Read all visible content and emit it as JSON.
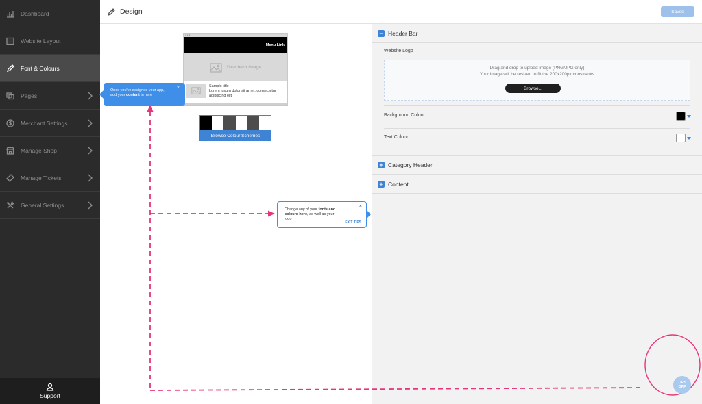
{
  "sidebar": {
    "items": [
      {
        "label": "Dashboard",
        "icon": "dashboard-icon",
        "chevron": false,
        "active": false
      },
      {
        "label": "Website Layout",
        "icon": "layout-icon",
        "chevron": false,
        "active": false
      },
      {
        "label": "Font & Colours",
        "icon": "pencil-icon",
        "chevron": false,
        "active": true
      },
      {
        "label": "Pages",
        "icon": "pages-icon",
        "chevron": true,
        "active": false
      },
      {
        "label": "Merchant Settings",
        "icon": "dollar-icon",
        "chevron": true,
        "active": false
      },
      {
        "label": "Manage Shop",
        "icon": "shop-icon",
        "chevron": true,
        "active": false
      },
      {
        "label": "Manage Tickets",
        "icon": "ticket-icon",
        "chevron": true,
        "active": false
      },
      {
        "label": "General Settings",
        "icon": "tools-icon",
        "chevron": true,
        "active": false
      }
    ],
    "support_label": "Support"
  },
  "topbar": {
    "title": "Design",
    "saved_label": "Saved"
  },
  "preview": {
    "menu_link": "Menu Link",
    "hero_text": "Your hero image",
    "sample_title": "Sample title",
    "sample_body": "Lorem ipsum dolor sit amet, consectetur adipiscing elit.",
    "swatch_colors": [
      "#000000",
      "#ffffff",
      "#4d4d4d",
      "#ffffff",
      "#4d4d4d",
      "#ffffff"
    ],
    "browse_schemes": "Browse Colour Schemes"
  },
  "panel": {
    "header_bar": "Header Bar",
    "header_bar_toggle": "−",
    "website_logo": "Website Logo",
    "drop_line1": "Drag and drop to upload image (PNG/JPG only)",
    "drop_line2": "Your image will be resized to fit the 200x200px constraints",
    "browse": "Browse...",
    "background_colour": "Background Colour",
    "background_value": "#000000",
    "text_colour": "Text Colour",
    "text_value": "#ffffff",
    "category_header": "Category Header",
    "category_toggle": "+",
    "content": "Content",
    "content_toggle": "+"
  },
  "tips": {
    "blue_text_1": "Once you've designed your app,",
    "blue_text_2a": "add your ",
    "blue_text_bold": "content",
    "blue_text_2b": " in here",
    "white_text_1": "Change any of your ",
    "white_text_bold1": "fonts and",
    "white_text_bold2": "colours here",
    "white_text_2": ", as well as your",
    "white_text_3": "logo",
    "exit_tips": "EXIT TIPS",
    "close": "×",
    "tips_off_1": "TIPS",
    "tips_off_2": "OFF"
  },
  "colors": {
    "accent": "#3f83d4",
    "tip_blue": "#3f8ee8",
    "annotation_pink": "#e6357a",
    "sidebar_bg": "#2b2b2b"
  }
}
